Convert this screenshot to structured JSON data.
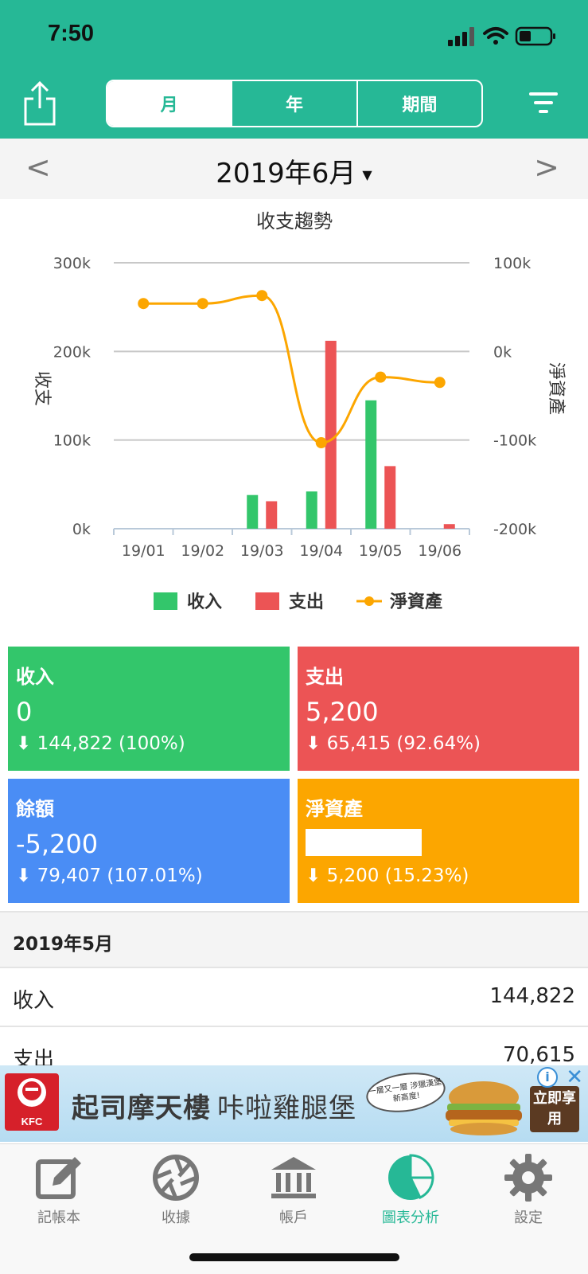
{
  "status_bar": {
    "time": "7:50"
  },
  "header": {
    "segments": [
      {
        "label": "月",
        "active": true
      },
      {
        "label": "年",
        "active": false
      },
      {
        "label": "期間",
        "active": false
      }
    ]
  },
  "month_nav": {
    "prev": "<",
    "next": ">",
    "title": "2019年6月"
  },
  "chart_data": {
    "type": "bar",
    "title": "收支趨勢",
    "categories": [
      "19/01",
      "19/02",
      "19/03",
      "19/04",
      "19/05",
      "19/06"
    ],
    "ylabel": "收支",
    "y2label": "淨資產",
    "ylim": [
      0,
      300000
    ],
    "y2lim": [
      -200000,
      100000
    ],
    "yticks": [
      "300k",
      "200k",
      "100k",
      "0k"
    ],
    "y2ticks": [
      "100k",
      "0k",
      "-100k",
      "-200k"
    ],
    "grid": true,
    "legend_position": "bottom",
    "series": [
      {
        "name": "收入",
        "type": "bar",
        "color": "#33c66b",
        "values": [
          0,
          0,
          38000,
          42000,
          144822,
          0
        ]
      },
      {
        "name": "支出",
        "type": "bar",
        "color": "#ec5455",
        "values": [
          0,
          0,
          31000,
          212000,
          70615,
          5200
        ]
      },
      {
        "name": "淨資產",
        "type": "line",
        "color": "#fca600",
        "values": [
          54000,
          54000,
          63000,
          -103000,
          -29000,
          -35000
        ]
      }
    ]
  },
  "cards": {
    "income": {
      "label": "收入",
      "value": "0",
      "change": "144,822 (100%)",
      "color": "#33c66b"
    },
    "expense": {
      "label": "支出",
      "value": "5,200",
      "change": "65,415 (92.64%)",
      "color": "#ec5455"
    },
    "balance": {
      "label": "餘額",
      "value": "-5,200",
      "change": "79,407 (107.01%)",
      "color": "#4a8df5"
    },
    "net": {
      "label": "淨資產",
      "change": "5,200 (15.23%)",
      "color": "#fca600"
    }
  },
  "summary": {
    "section_title": "2019年5月",
    "rows": [
      {
        "label": "收入",
        "value": "144,822"
      },
      {
        "label": "支出",
        "value": "70,615"
      }
    ]
  },
  "ad": {
    "logo_text": "KFC",
    "title_bold": "起司摩天樓",
    "title_light": "咔啦雞腿堡",
    "bubble": "一層又一層 涉獵漢堡新高度!",
    "cta": "立即享用"
  },
  "tabbar": {
    "items": [
      {
        "label": "記帳本",
        "icon": "notebook-edit-icon",
        "active": false
      },
      {
        "label": "收據",
        "icon": "aperture-icon",
        "active": false
      },
      {
        "label": "帳戶",
        "icon": "bank-icon",
        "active": false
      },
      {
        "label": "圖表分析",
        "icon": "pie-chart-icon",
        "active": true
      },
      {
        "label": "設定",
        "icon": "gear-icon",
        "active": false
      }
    ]
  }
}
